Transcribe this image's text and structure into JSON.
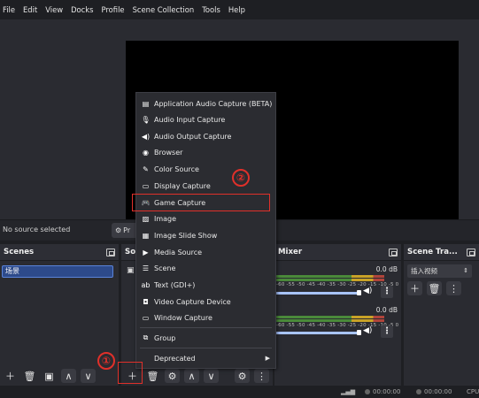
{
  "menubar": [
    "File",
    "Edit",
    "View",
    "Docks",
    "Profile",
    "Scene Collection",
    "Tools",
    "Help"
  ],
  "source_bar": {
    "no_source": "No source selected",
    "properties_label": "Pr"
  },
  "docks": {
    "scenes": {
      "title": "Scenes",
      "items": [
        "场景"
      ]
    },
    "sources": {
      "title": "Sou"
    },
    "mixer": {
      "title": "Mixer",
      "channels": [
        {
          "db": "0.0 dB",
          "scale": "-60 -55 -50 -45 -40 -35 -30 -25 -20 -15 -10 -5 0"
        },
        {
          "db": "0.0 dB",
          "scale": "-60 -55 -50 -45 -40 -35 -30 -25 -20 -15 -10 -5 0"
        }
      ]
    },
    "transitions": {
      "title": "Scene Tra...",
      "selected": "插入视频"
    }
  },
  "context_menu": {
    "items": [
      {
        "label": "Application Audio Capture (BETA)",
        "icon": "app-audio-icon"
      },
      {
        "label": "Audio Input Capture",
        "icon": "microphone-icon"
      },
      {
        "label": "Audio Output Capture",
        "icon": "speaker-icon"
      },
      {
        "label": "Browser",
        "icon": "globe-icon"
      },
      {
        "label": "Color Source",
        "icon": "brush-icon"
      },
      {
        "label": "Display Capture",
        "icon": "monitor-icon"
      },
      {
        "label": "Game Capture",
        "icon": "gamepad-icon"
      },
      {
        "label": "Image",
        "icon": "image-icon"
      },
      {
        "label": "Image Slide Show",
        "icon": "slideshow-icon"
      },
      {
        "label": "Media Source",
        "icon": "play-icon"
      },
      {
        "label": "Scene",
        "icon": "scene-icon"
      },
      {
        "label": "Text (GDI+)",
        "icon": "text-icon"
      },
      {
        "label": "Video Capture Device",
        "icon": "camera-icon"
      },
      {
        "label": "Window Capture",
        "icon": "window-icon"
      }
    ],
    "group": "Group",
    "deprecated": "Deprecated"
  },
  "annotations": {
    "step1": "①",
    "step2": "②"
  },
  "status": {
    "time1": "00:00:00",
    "time2": "00:00:00",
    "cpu": "CPU"
  },
  "colors": {
    "highlight": "#e0302a",
    "scene_selected": "#2d4a8a",
    "preview": "#000000"
  }
}
